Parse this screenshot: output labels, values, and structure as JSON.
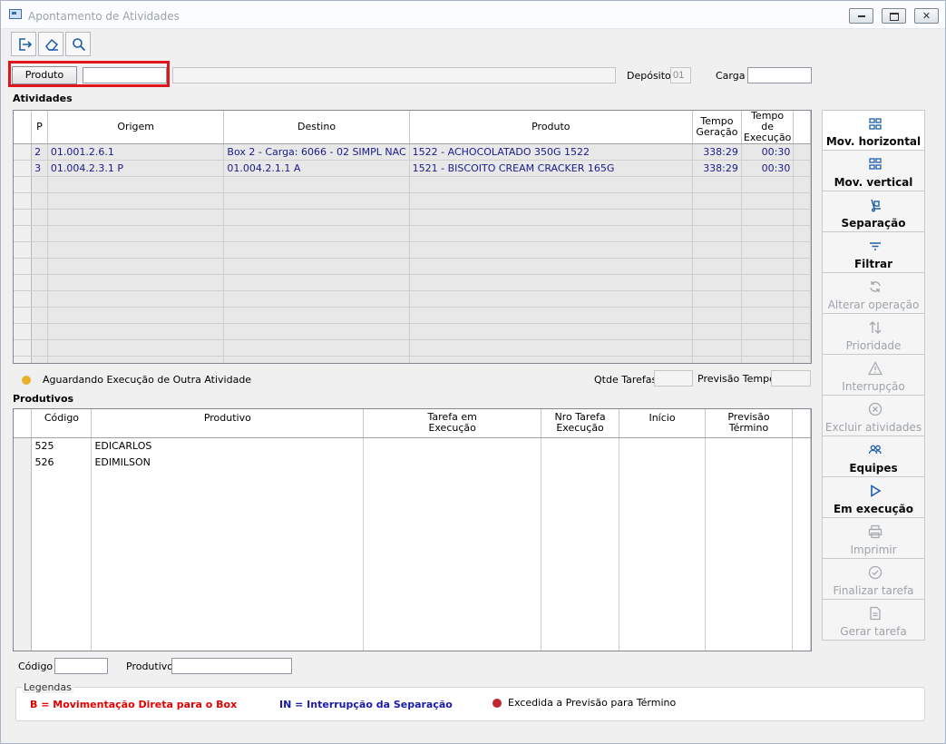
{
  "window": {
    "title": "Apontamento de Atividades",
    "controls": {
      "minimize": "—",
      "maximize": "□",
      "close": "✕"
    }
  },
  "toolbar": {
    "icons": [
      "exit-icon",
      "eraser-icon",
      "search-icon"
    ]
  },
  "filter": {
    "produto_label": "Produto",
    "produto_code": "",
    "produto_desc": "",
    "deposito_label": "Depósito",
    "deposito_value": "01",
    "carga_label": "Carga",
    "carga_value": ""
  },
  "atividades": {
    "title": "Atividades",
    "columns": [
      "P",
      "Origem",
      "Destino",
      "Produto",
      "Tempo Geração",
      "Tempo de Execução"
    ],
    "col_tempo_geracao_1": "Tempo",
    "col_tempo_geracao_2": "Geração",
    "col_tempo_exec_1": "Tempo de",
    "col_tempo_exec_2": "Execução",
    "rows": [
      {
        "p": "2",
        "origem": "01.001.2.6.1",
        "destino": "Box 2 - Carga: 6066 - 02 SIMPL NAC",
        "produto": "1522 - ACHOCOLATADO 350G 1522",
        "tempo_geracao": "338:29",
        "tempo_execucao": "00:30"
      },
      {
        "p": "3",
        "origem": "01.004.2.3.1 P",
        "destino": "01.004.2.1.1 A",
        "produto": "1521 - BISCOITO CREAM CRACKER 165G",
        "tempo_geracao": "338:29",
        "tempo_execucao": "00:30"
      }
    ],
    "empty_rows": 12,
    "status_legend": "Aguardando Execução de Outra Atividade",
    "status_color": "#e8b12a",
    "qtde_tarefas_label": "Qtde Tarefas",
    "qtde_tarefas_value": "",
    "previsao_tempo_label": "Previsão Tempo",
    "previsao_tempo_value": ""
  },
  "produtivos": {
    "title": "Produtivos",
    "col_codigo": "Código",
    "col_produtivo": "Produtivo",
    "col_tarefa_1": "Tarefa em",
    "col_tarefa_2": "Execução",
    "col_nro_1": "Nro Tarefa",
    "col_nro_2": "Execução",
    "col_inicio": "Início",
    "col_prev_1": "Previsão",
    "col_prev_2": "Término",
    "rows": [
      {
        "codigo": "525",
        "produtivo": "EDICARLOS"
      },
      {
        "codigo": "526",
        "produtivo": "EDIMILSON"
      }
    ],
    "codigo_label": "Código",
    "codigo_value": "",
    "produtivo_label": "Produtivo",
    "produtivo_value": ""
  },
  "actions": [
    {
      "label": "Mov. horizontal",
      "icon": "horizontal-move-icon",
      "enabled": true
    },
    {
      "label": "Mov. vertical",
      "icon": "vertical-move-icon",
      "enabled": true
    },
    {
      "label": "Separação",
      "icon": "hand-truck-icon",
      "enabled": true
    },
    {
      "label": "Filtrar",
      "icon": "filter-icon",
      "enabled": true
    },
    {
      "label": "Alterar operação",
      "icon": "refresh-icon",
      "enabled": false
    },
    {
      "label": "Prioridade",
      "icon": "sort-arrows-icon",
      "enabled": false
    },
    {
      "label": "Interrupção",
      "icon": "warning-icon",
      "enabled": false
    },
    {
      "label": "Excluir atividades",
      "icon": "delete-circle-icon",
      "enabled": false
    },
    {
      "label": "Equipes",
      "icon": "team-icon",
      "enabled": true
    },
    {
      "label": "Em execução",
      "icon": "play-icon",
      "enabled": true
    },
    {
      "label": "Imprimir",
      "icon": "print-icon",
      "enabled": false
    },
    {
      "label": "Finalizar tarefa",
      "icon": "check-circle-icon",
      "enabled": false
    },
    {
      "label": "Gerar tarefa",
      "icon": "document-icon",
      "enabled": false
    }
  ],
  "legend": {
    "title": "Legendas",
    "b_text": "B = Movimentação Direta para o Box",
    "b_color": "#e00000",
    "in_text": "IN = Interrupção da Separação",
    "in_color": "#1a1aa8",
    "exceeded_text": "Excedida a Previsão para Término",
    "exceeded_color": "#c0282d"
  },
  "highlight_color": "#e0161c"
}
